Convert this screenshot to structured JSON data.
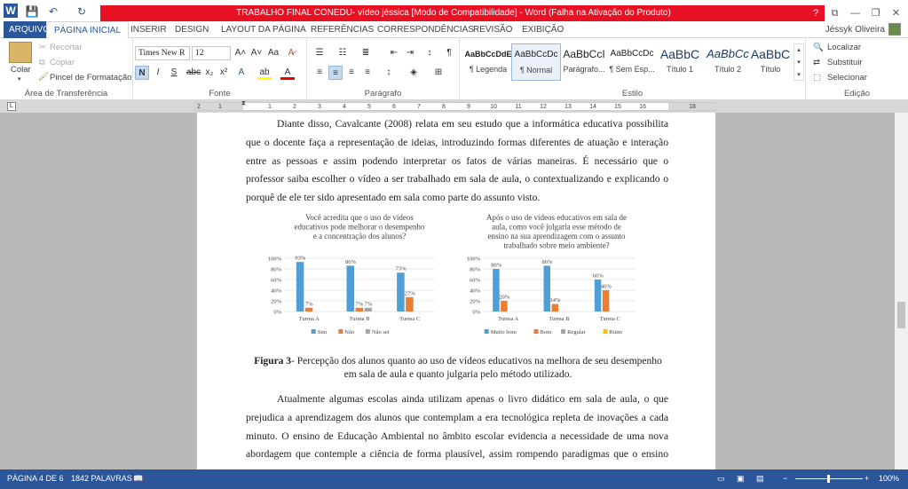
{
  "window": {
    "title": "TRABALHO FINAL CONEDU- vídeo jéssica [Modo de Compatibilidade] -  Word (Falha na Ativação do Produto)",
    "controls": [
      "?",
      "⧉",
      "—",
      "❐",
      "✕"
    ]
  },
  "tabs": {
    "file": "ARQUIVO",
    "items": [
      "PÁGINA INICIAL",
      "INSERIR",
      "DESIGN",
      "LAYOUT DA PÁGINA",
      "REFERÊNCIAS",
      "CORRESPONDÊNCIAS",
      "REVISÃO",
      "EXIBIÇÃO"
    ],
    "user": "Jéssyk Oliveira"
  },
  "ribbon": {
    "clipboard": {
      "paste": "Colar",
      "cut": "Recortar",
      "copy": "Copiar",
      "painter": "Pincel de Formatação",
      "label": "Área de Transferência"
    },
    "font": {
      "name": "Times New R",
      "size": "12",
      "label": "Fonte"
    },
    "paragraph": {
      "label": "Parágrafo"
    },
    "styles": {
      "items": [
        {
          "preview": "AaBbCcDdE",
          "name": "¶ Legenda"
        },
        {
          "preview": "AaBbCcDc",
          "name": "¶ Normal"
        },
        {
          "preview": "AaBbCcI",
          "name": "Parágrafo..."
        },
        {
          "preview": "AaBbCcDc",
          "name": "¶ Sem Esp..."
        },
        {
          "preview": "AaBbC",
          "name": "Título 1"
        },
        {
          "preview": "AaBbCc",
          "name": "Título 2"
        },
        {
          "preview": "AaBbC",
          "name": "Título"
        }
      ],
      "label": "Estilo"
    },
    "editing": {
      "find": "Localizar",
      "replace": "Substituir",
      "select": "Selecionar",
      "label": "Edição"
    }
  },
  "ruler": {
    "numbers": [
      "2",
      "1",
      "1",
      "2",
      "3",
      "4",
      "5",
      "6",
      "7",
      "8",
      "9",
      "10",
      "11",
      "12",
      "13",
      "14",
      "15",
      "16",
      "18"
    ]
  },
  "document": {
    "para1": [
      "Diante disso, Cavalcante (2008) relata em seu estudo que a informática educativa possibilita",
      "que o docente faça a representação de ideias, introduzindo formas diferentes de atuação e interação",
      "entre as pessoas e assim podendo interpretar os fatos de várias maneiras. É necessário que o",
      "professor saiba escolher o vídeo a ser trabalhado em sala de aula, o contextualizando e explicando o",
      "porquê de ele ter sido apresentado em sala como parte do assunto visto."
    ],
    "caption": {
      "label": "Figura 3",
      "line1": "- Percepção dos alunos quanto ao uso de vídeos educativos na melhora de seu desempenho",
      "line2": "em sala de aula e quanto julgaria pelo método utilizado."
    },
    "para2": [
      "Atualmente algumas escolas ainda utilizam apenas o livro didático em sala de aula, o que",
      "prejudica a aprendizagem dos alunos que contemplam a era tecnológica repleta de inovações a cada",
      "minuto. O ensino de Educação Ambiental no âmbito escolar evidencia a necessidade de uma nova",
      "abordagem que contemple a ciência de forma plausível, assim rompendo paradigmas que o ensino"
    ]
  },
  "chart_data": [
    {
      "type": "bar",
      "title": "Você acredita que o uso de vídeos educativos pode melhorar o desempenho e a concentração dos alunos?",
      "title_lines": [
        "Você acredita que o uso de vídeos",
        "educativos pode melhorar o desempenho",
        "e a concentração dos alunos?"
      ],
      "categories": [
        "Turma A",
        "Turma B",
        "Turma C"
      ],
      "ylim": [
        0,
        100
      ],
      "yticks": [
        "0%",
        "20%",
        "40%",
        "60%",
        "80%",
        "100%"
      ],
      "legend_position": "bottom",
      "series": [
        {
          "name": "Sim",
          "values": [
            93,
            86,
            73
          ],
          "labels": [
            "93%",
            "86%",
            "73%"
          ],
          "color": "#4f9ed6"
        },
        {
          "name": "Não",
          "values": [
            7,
            7,
            27
          ],
          "labels": [
            "7%",
            "7%",
            "27%"
          ],
          "color": "#ed7d31"
        },
        {
          "name": "Não sei",
          "values": [
            0,
            7,
            0
          ],
          "labels": [
            "",
            "7%",
            ""
          ],
          "color": "#a5a5a5"
        }
      ]
    },
    {
      "type": "bar",
      "title": "Após o uso de vídeos educativos em sala de aula, como você julgaria esse método de ensino na sua aprendizagem com o assunto trabalhado sobre meio ambiente?",
      "title_lines": [
        "Após o uso de vídeos educativos em sala de",
        "aula, como você julgaria esse método de",
        "ensino na sua aprendizagem com o assunto",
        "trabalhado sobre meio ambiente?"
      ],
      "categories": [
        "Turma A",
        "Turma B",
        "Turma C"
      ],
      "ylim": [
        0,
        100
      ],
      "yticks": [
        "0%",
        "20%",
        "40%",
        "60%",
        "80%",
        "100%"
      ],
      "legend_position": "bottom",
      "series": [
        {
          "name": "Muito bom",
          "values": [
            80,
            86,
            60
          ],
          "labels": [
            "80%",
            "86%",
            "60%"
          ],
          "color": "#4f9ed6"
        },
        {
          "name": "Bom",
          "values": [
            20,
            14,
            40
          ],
          "labels": [
            "20%",
            "14%",
            "40%"
          ],
          "color": "#ed7d31"
        },
        {
          "name": "Regular",
          "values": [
            0,
            0,
            0
          ],
          "labels": [
            "",
            "",
            ""
          ],
          "color": "#a5a5a5"
        },
        {
          "name": "Ruim",
          "values": [
            0,
            0,
            0
          ],
          "labels": [
            "",
            "",
            ""
          ],
          "color": "#ffc000"
        }
      ]
    }
  ],
  "status": {
    "page": "PÁGINA 4 DE 6",
    "words": "1842 PALAVRAS",
    "zoom": "100%"
  }
}
